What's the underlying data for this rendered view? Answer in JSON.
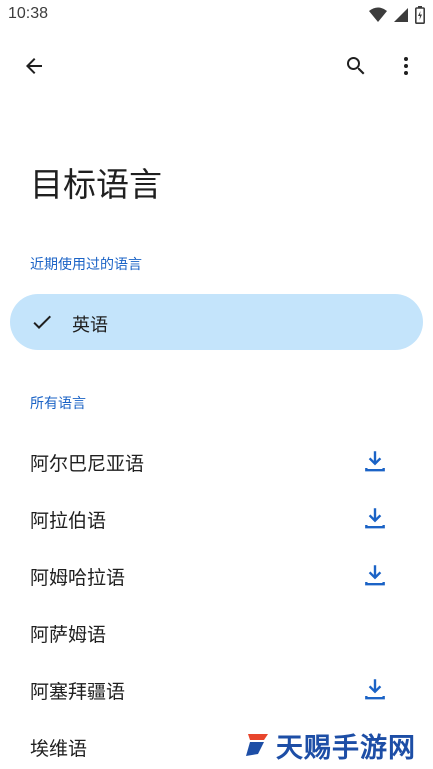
{
  "status_bar": {
    "time": "10:38"
  },
  "app_bar": {
    "back_icon": "arrow-back-icon",
    "search_icon": "search-icon",
    "more_icon": "more-vert-icon"
  },
  "page_title": "目标语言",
  "recent_section": {
    "label": "近期使用过的语言",
    "items": [
      {
        "label": "英语",
        "selected": true
      }
    ]
  },
  "all_section": {
    "label": "所有语言",
    "items": [
      {
        "label": "阿尔巴尼亚语",
        "downloadable": true
      },
      {
        "label": "阿拉伯语",
        "downloadable": true
      },
      {
        "label": "阿姆哈拉语",
        "downloadable": true
      },
      {
        "label": "阿萨姆语",
        "downloadable": false
      },
      {
        "label": "阿塞拜疆语",
        "downloadable": true
      },
      {
        "label": "埃维语",
        "downloadable": false
      }
    ]
  },
  "watermark": {
    "text": "天赐手游网"
  },
  "colors": {
    "accent": "#1b63c6",
    "selected_bg": "#c4e4fb"
  }
}
